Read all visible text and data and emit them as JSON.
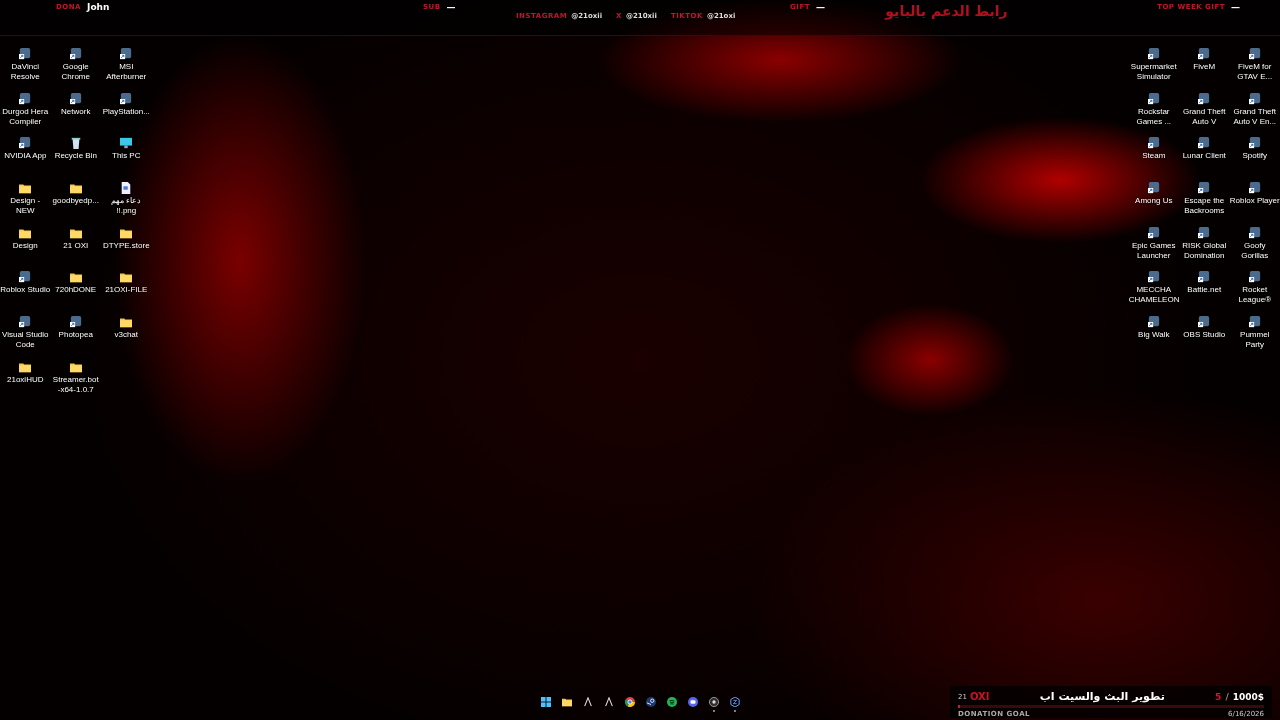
{
  "stream_bar": {
    "stats": [
      {
        "label": "DONA",
        "value": "John"
      },
      {
        "label": "SUB",
        "value": "—"
      },
      {
        "label": "GIFT",
        "value": "—"
      },
      {
        "label": "TOP WEEK GIFT",
        "value": "—"
      }
    ],
    "socials": [
      {
        "label": "INSTAGRAM",
        "handle": "@21oxii"
      },
      {
        "label": "X",
        "handle": "@210xii"
      },
      {
        "label": "TIKTOK",
        "handle": "@21oxi"
      }
    ],
    "support_link": "رابط الدعم بالبايو"
  },
  "left_icons": [
    {
      "label": "DaVinci Resolve",
      "kind": "app"
    },
    {
      "label": "Google Chrome",
      "kind": "app"
    },
    {
      "label": "MSI Afterburner",
      "kind": "app"
    },
    {
      "label": "Durgod Hera Compiler",
      "kind": "app"
    },
    {
      "label": "Network",
      "kind": "app"
    },
    {
      "label": "PlayStation...",
      "kind": "app"
    },
    {
      "label": "NVIDIA App",
      "kind": "app"
    },
    {
      "label": "Recycle Bin",
      "kind": "bin"
    },
    {
      "label": "This PC",
      "kind": "pc"
    },
    {
      "label": "Design - NEW",
      "kind": "folder"
    },
    {
      "label": "goodbyedp...",
      "kind": "folder"
    },
    {
      "label": "دعاء مهم !!.png",
      "kind": "file"
    },
    {
      "label": "Design",
      "kind": "folder"
    },
    {
      "label": "21 OXI",
      "kind": "folder"
    },
    {
      "label": "DTYPE.store",
      "kind": "folder"
    },
    {
      "label": "Roblox Studio",
      "kind": "app"
    },
    {
      "label": "720hDONE",
      "kind": "folder"
    },
    {
      "label": "21OXI-FILE",
      "kind": "folder"
    },
    {
      "label": "Visual Studio Code",
      "kind": "app"
    },
    {
      "label": "Photopea",
      "kind": "app"
    },
    {
      "label": "v3chat",
      "kind": "folder"
    },
    {
      "label": "21oxiHUD",
      "kind": "folder"
    },
    {
      "label": "Streamer.bot -x64-1.0.7",
      "kind": "folder"
    }
  ],
  "right_icons": [
    {
      "label": "Supermarket Simulator",
      "kind": "app"
    },
    {
      "label": "FiveM",
      "kind": "app"
    },
    {
      "label": "FiveM for GTAV E...",
      "kind": "app"
    },
    {
      "label": "Rockstar Games ...",
      "kind": "app"
    },
    {
      "label": "Grand Theft Auto V",
      "kind": "app"
    },
    {
      "label": "Grand Theft Auto V En...",
      "kind": "app"
    },
    {
      "label": "Steam",
      "kind": "app"
    },
    {
      "label": "Lunar Client",
      "kind": "app"
    },
    {
      "label": "Spotify",
      "kind": "app"
    },
    {
      "label": "Among Us",
      "kind": "app"
    },
    {
      "label": "Escape the Backrooms",
      "kind": "app"
    },
    {
      "label": "Roblox Player",
      "kind": "app"
    },
    {
      "label": "Epic Games Launcher",
      "kind": "app"
    },
    {
      "label": "RISK Global Domination",
      "kind": "app"
    },
    {
      "label": "Goofy Gorillas",
      "kind": "app"
    },
    {
      "label": "MECCHA CHAMELEON",
      "kind": "app"
    },
    {
      "label": "Battle.net",
      "kind": "app"
    },
    {
      "label": "Rocket League®",
      "kind": "app"
    },
    {
      "label": "Big Walk",
      "kind": "app"
    },
    {
      "label": "OBS Studio",
      "kind": "app"
    },
    {
      "label": "Pummel Party",
      "kind": "app"
    }
  ],
  "taskbar": [
    {
      "kind": "start",
      "running": false
    },
    {
      "kind": "folder",
      "running": false
    },
    {
      "kind": "letter",
      "running": false
    },
    {
      "kind": "letter",
      "running": false
    },
    {
      "kind": "browser",
      "running": false
    },
    {
      "kind": "steam",
      "running": false
    },
    {
      "kind": "music",
      "running": false
    },
    {
      "kind": "chat",
      "running": false
    },
    {
      "kind": "obs",
      "running": true
    },
    {
      "kind": "app",
      "running": true
    }
  ],
  "donation_widget": {
    "channel_number": "21",
    "channel_name": "OXI",
    "goal_title": "تطوير البث والسيت اب",
    "current": "5",
    "separator": "/",
    "target": "1000$",
    "caption": "DONATION GOAL",
    "level": 0.005,
    "date": "6/16/2026"
  }
}
